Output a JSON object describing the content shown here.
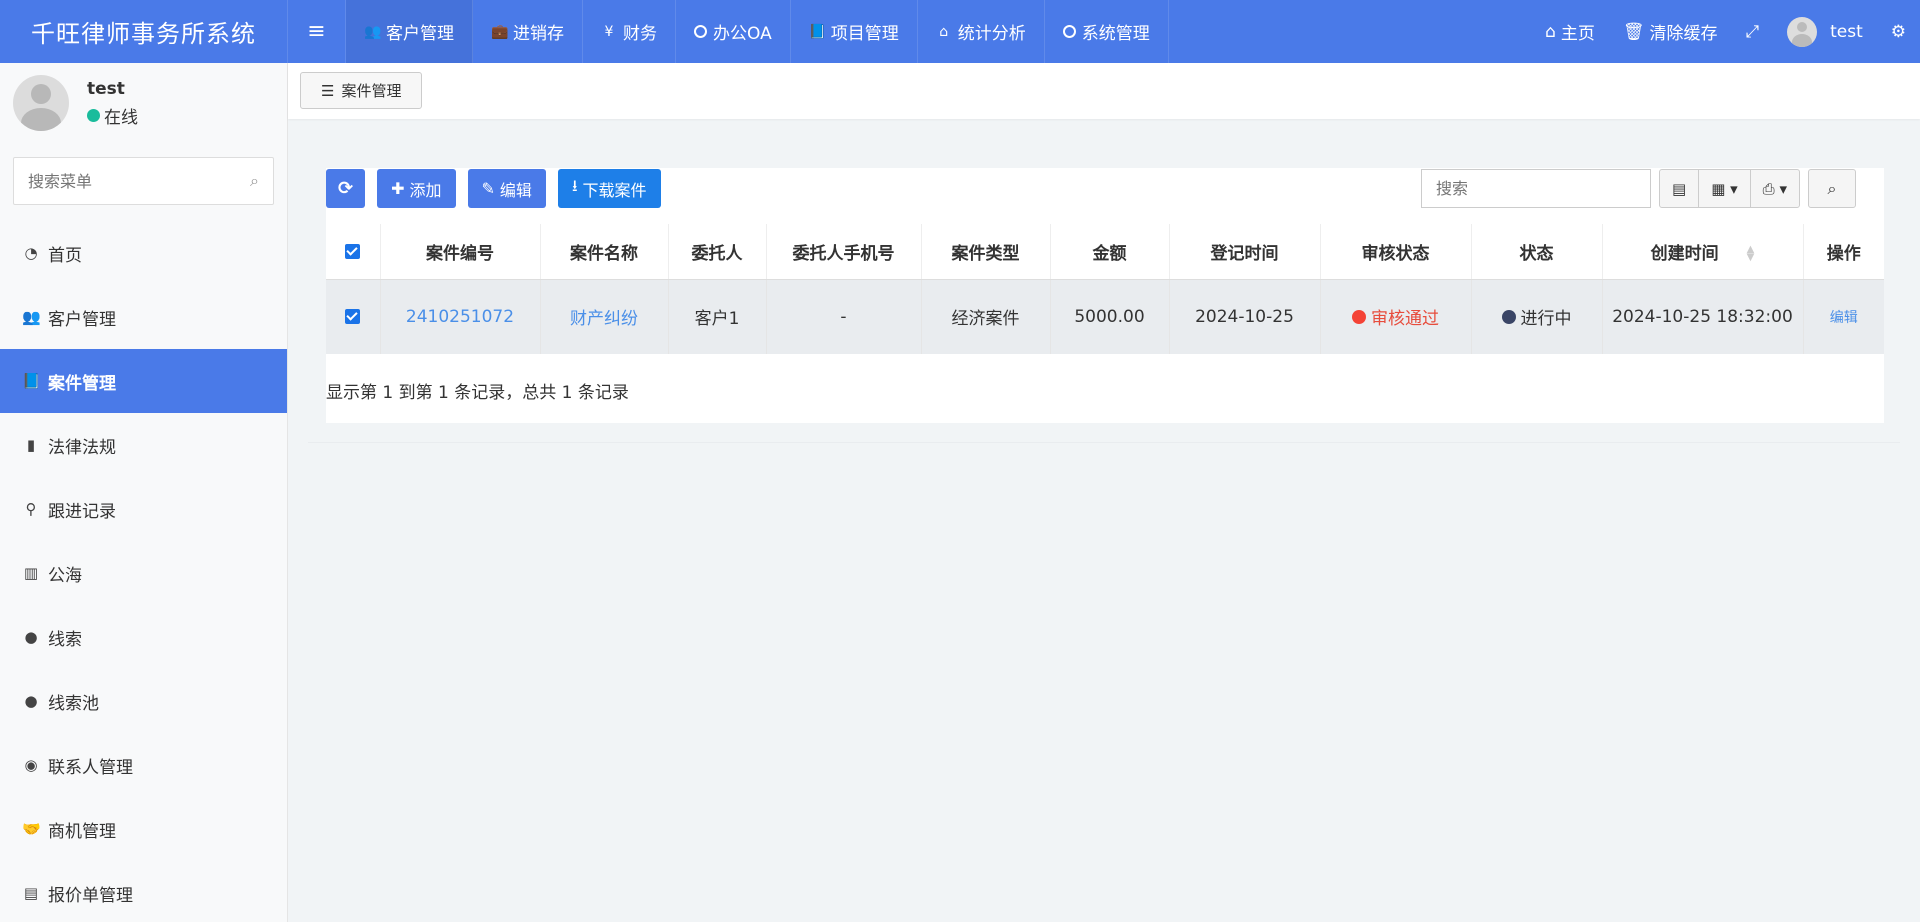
{
  "header": {
    "brand": "千旺律师事务所系统",
    "nav": [
      {
        "icon": "users-icon",
        "glyph": "👥",
        "label": "客户管理"
      },
      {
        "icon": "briefcase-icon",
        "glyph": "💼",
        "label": "进销存"
      },
      {
        "icon": "yen-icon",
        "glyph": "¥",
        "label": "财务"
      },
      {
        "icon": "circle-icon",
        "glyph": "",
        "label": "办公OA"
      },
      {
        "icon": "book-icon",
        "glyph": "📘",
        "label": "项目管理"
      },
      {
        "icon": "home-icon",
        "glyph": "⌂",
        "label": "统计分析"
      },
      {
        "icon": "circle-icon",
        "glyph": "",
        "label": "系统管理"
      }
    ],
    "home_label": "主页",
    "clear_cache_label": "清除缓存",
    "username": "test"
  },
  "sidebar": {
    "username": "test",
    "status": "在线",
    "search_placeholder": "搜索菜单",
    "items": [
      {
        "icon": "dashboard-icon",
        "glyph": "◔",
        "label": "首页"
      },
      {
        "icon": "users-icon",
        "glyph": "👥",
        "label": "客户管理"
      },
      {
        "icon": "book-icon",
        "glyph": "📘",
        "label": "案件管理"
      },
      {
        "icon": "law-icon",
        "glyph": "▮",
        "label": "法律法规"
      },
      {
        "icon": "follow-icon",
        "glyph": "⚲",
        "label": "跟进记录"
      },
      {
        "icon": "map-icon",
        "glyph": "▥",
        "label": "公海"
      },
      {
        "icon": "user-icon",
        "glyph": "●",
        "label": "线索"
      },
      {
        "icon": "user-icon",
        "glyph": "●",
        "label": "线索池"
      },
      {
        "icon": "contact-icon",
        "glyph": "◉",
        "label": "联系人管理"
      },
      {
        "icon": "handshake-icon",
        "glyph": "🤝",
        "label": "商机管理"
      },
      {
        "icon": "file-icon",
        "glyph": "▤",
        "label": "报价单管理"
      }
    ]
  },
  "tab": {
    "label": "案件管理"
  },
  "toolbar": {
    "add_label": "添加",
    "edit_label": "编辑",
    "download_label": "下载案件",
    "search_placeholder": "搜索"
  },
  "table": {
    "headers": [
      "案件编号",
      "案件名称",
      "委托人",
      "委托人手机号",
      "案件类型",
      "金额",
      "登记时间",
      "审核状态",
      "状态",
      "创建时间",
      "操作"
    ],
    "rows": [
      {
        "case_no": "2410251072",
        "case_name": "财产纠纷",
        "client": "客户1",
        "phone": "-",
        "type": "经济案件",
        "amount": "5000.00",
        "register_date": "2024-10-25",
        "audit_status": "审核通过",
        "status": "进行中",
        "created_at": "2024-10-25 18:32:00",
        "action": "编辑"
      }
    ]
  },
  "pagination": {
    "info": "显示第 1 到第 1 条记录，总共 1 条记录"
  },
  "colors": {
    "primary": "#4a7ae8",
    "link": "#4a8fe8",
    "danger": "#f44336",
    "online": "#1abc9c"
  }
}
